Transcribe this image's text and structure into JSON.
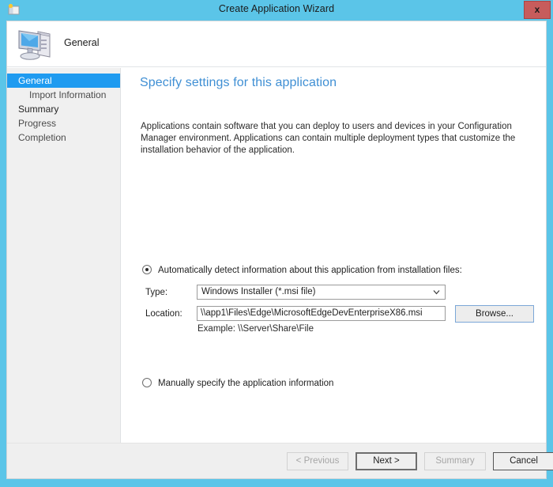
{
  "window": {
    "title": "Create Application Wizard",
    "title_icon": "wizard-app-icon",
    "close_label": "x",
    "frame_color": "#5bc5e8"
  },
  "header": {
    "icon": "computer-icon",
    "label": "General"
  },
  "sidebar": {
    "items": [
      {
        "label": "General",
        "state": "active",
        "indent": false
      },
      {
        "label": "Import Information",
        "state": "pending",
        "indent": true
      },
      {
        "label": "Summary",
        "state": "done",
        "indent": false
      },
      {
        "label": "Progress",
        "state": "pending",
        "indent": false
      },
      {
        "label": "Completion",
        "state": "pending",
        "indent": false
      }
    ],
    "highlight_color": "#1f9bf0"
  },
  "content": {
    "page_title": "Specify settings for this application",
    "description": "Applications contain software that you can deploy to users and devices in your Configuration Manager environment. Applications can contain multiple deployment types that customize the installation behavior of the application.",
    "title_color": "#3f8fd4",
    "option_auto": {
      "label": "Automatically detect information about this application from installation files:",
      "selected": true
    },
    "option_manual": {
      "label": "Manually specify the application information",
      "selected": false
    },
    "type_field": {
      "label": "Type:",
      "value": "Windows Installer (*.msi file)",
      "arrow_icon": "chevron-down-icon"
    },
    "location_field": {
      "label": "Location:",
      "value": "\\\\app1\\Files\\Edge\\MicrosoftEdgeDevEnterpriseX86.msi",
      "placeholder": "",
      "example": "Example: \\\\Server\\Share\\File"
    },
    "browse_button": "Browse..."
  },
  "footer": {
    "previous": "< Previous",
    "next": "Next >",
    "summary": "Summary",
    "cancel": "Cancel"
  }
}
